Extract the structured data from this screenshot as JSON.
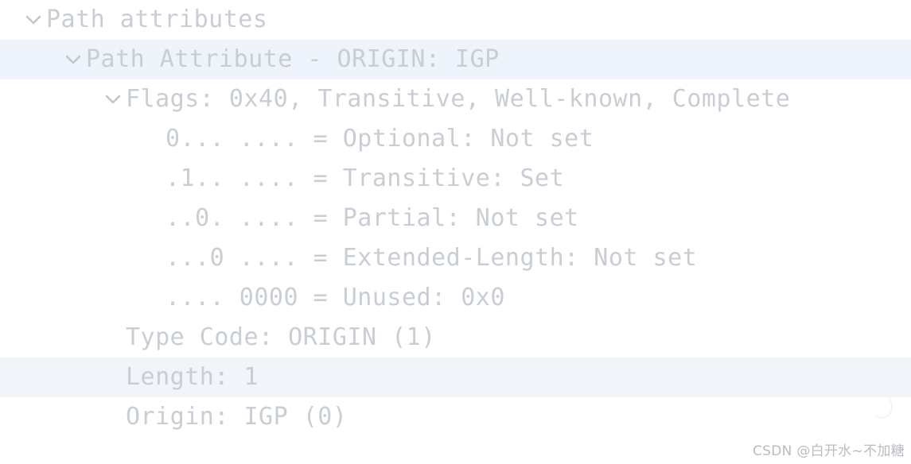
{
  "app": {
    "view_name": "packet-details-tree",
    "highlight_color": "#eef3fc",
    "secondary_highlight_color": "#f1f4f9",
    "text_color": "#c9cdd4"
  },
  "tree": {
    "rows": [
      {
        "label": "Path attributes",
        "indent": 0,
        "expander": "chevron-down",
        "highlight": "none",
        "name": "tree-node-path-attributes"
      },
      {
        "label": "Path Attribute - ORIGIN: IGP",
        "indent": 1,
        "expander": "chevron-down",
        "highlight": "blue",
        "name": "tree-node-path-attribute-origin"
      },
      {
        "label": "Flags: 0x40, Transitive, Well-known, Complete",
        "indent": 2,
        "expander": "chevron-down",
        "highlight": "none",
        "name": "tree-node-flags"
      },
      {
        "label": "0... .... = Optional: Not set",
        "indent": 3,
        "expander": "none",
        "highlight": "none",
        "name": "tree-node-flag-optional"
      },
      {
        "label": ".1.. .... = Transitive: Set",
        "indent": 3,
        "expander": "none",
        "highlight": "none",
        "name": "tree-node-flag-transitive"
      },
      {
        "label": "..0. .... = Partial: Not set",
        "indent": 3,
        "expander": "none",
        "highlight": "none",
        "name": "tree-node-flag-partial"
      },
      {
        "label": "...0 .... = Extended-Length: Not set",
        "indent": 3,
        "expander": "none",
        "highlight": "none",
        "name": "tree-node-flag-extended-length"
      },
      {
        "label": ".... 0000 = Unused: 0x0",
        "indent": 3,
        "expander": "none",
        "highlight": "none",
        "name": "tree-node-flag-unused"
      },
      {
        "label": "Type Code: ORIGIN (1)",
        "indent": 2,
        "expander": "none",
        "highlight": "none",
        "name": "tree-node-type-code"
      },
      {
        "label": "Length: 1",
        "indent": 2,
        "expander": "none",
        "highlight": "grey",
        "name": "tree-node-length"
      },
      {
        "label": "Origin: IGP (0)",
        "indent": 2,
        "expander": "none",
        "highlight": "none",
        "name": "tree-node-origin"
      }
    ]
  },
  "watermark": {
    "text": "CSDN @白开水~不加糖"
  }
}
